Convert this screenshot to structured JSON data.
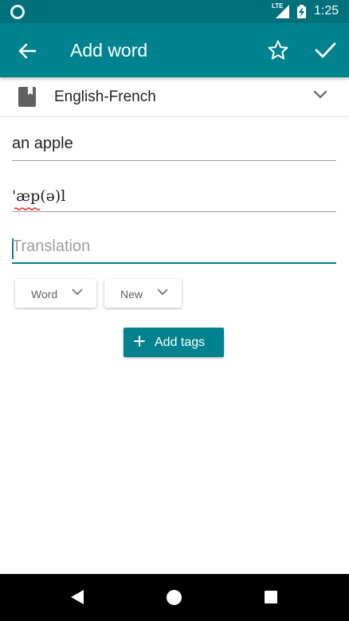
{
  "status_bar": {
    "network_label": "LTE",
    "time": "1:25"
  },
  "app_bar": {
    "title": "Add word",
    "back_icon": "arrow-back-icon",
    "favorite_icon": "star-outline-icon",
    "save_icon": "check-icon"
  },
  "dictionary": {
    "icon": "book-icon",
    "selected": "English-French"
  },
  "form": {
    "word_value": "an apple",
    "transcription_value": "'æp(ə)l",
    "translation_value": "",
    "translation_placeholder": "Translation"
  },
  "dropdowns": {
    "part_of_speech": "Word",
    "status": "New"
  },
  "tags": {
    "add_label": "Add tags"
  },
  "colors": {
    "primary": "#00838f",
    "primary_dark": "#00707a",
    "spellcheck": "#e53935"
  }
}
